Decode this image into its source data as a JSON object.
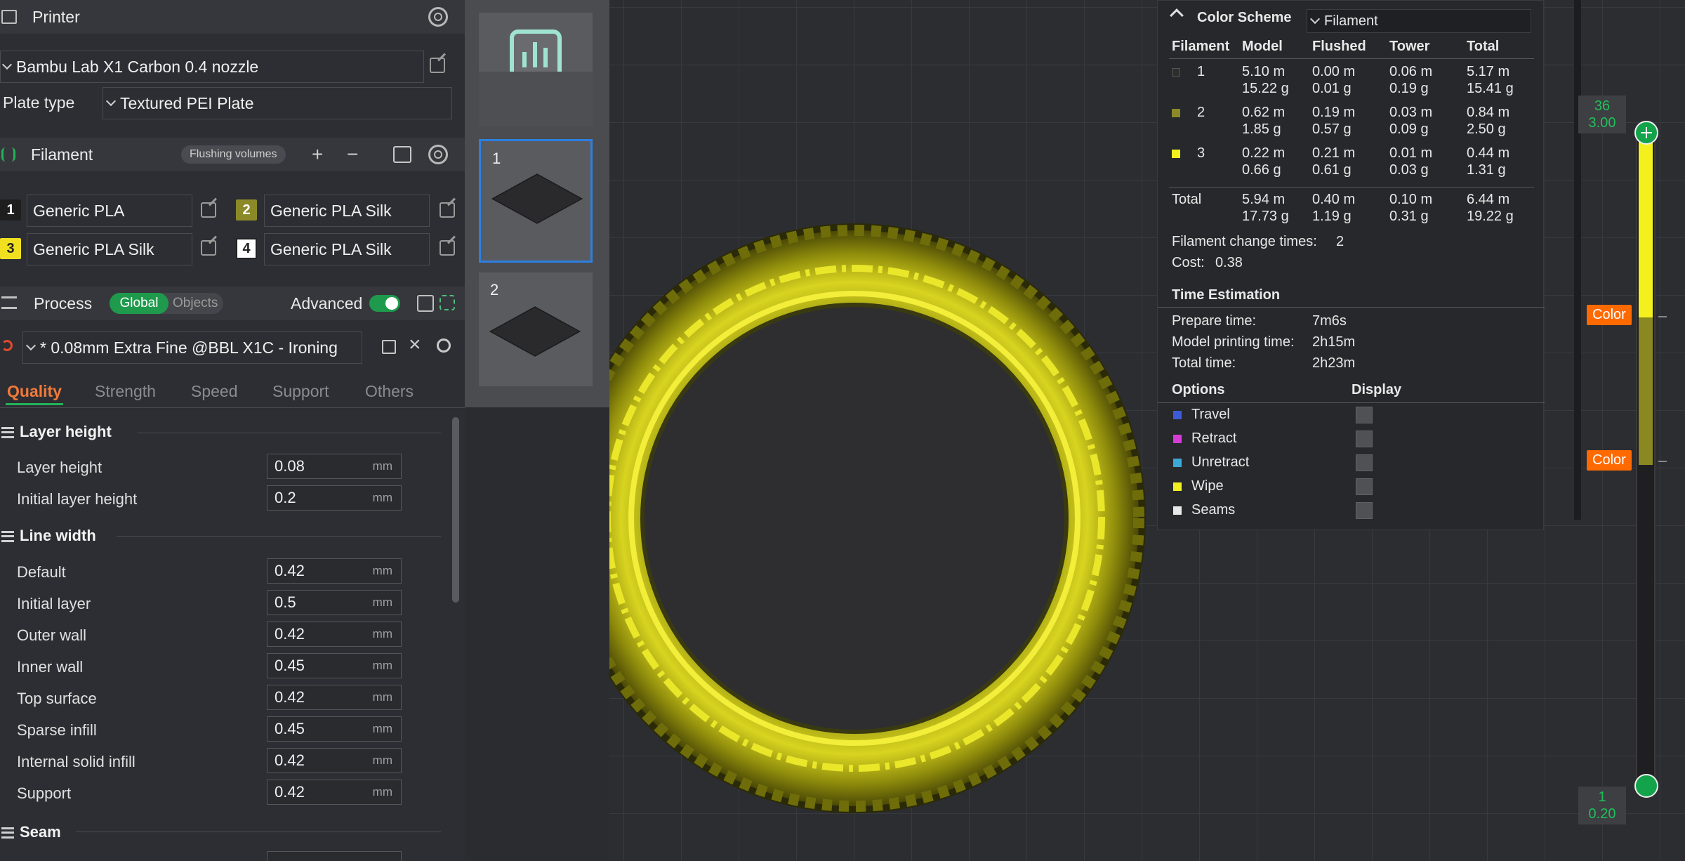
{
  "printer": {
    "title": "Printer",
    "preset": "Bambu Lab X1 Carbon 0.4 nozzle",
    "plate_type_label": "Plate type",
    "plate_type_value": "Textured PEI Plate"
  },
  "filament": {
    "title": "Filament",
    "flushing_label": "Flushing volumes",
    "items": [
      {
        "index": "1",
        "name": "Generic PLA",
        "color": "#1e1e1e",
        "text_color": "#ffffff"
      },
      {
        "index": "2",
        "name": "Generic PLA Silk",
        "color": "#8c8a28",
        "text_color": "#ffffff"
      },
      {
        "index": "3",
        "name": "Generic PLA Silk",
        "color": "#f0e020",
        "text_color": "#222222"
      },
      {
        "index": "4",
        "name": "Generic PLA Silk",
        "color": "#ffffff",
        "text_color": "#222222"
      }
    ]
  },
  "process": {
    "title": "Process",
    "global_label": "Global",
    "objects_label": "Objects",
    "advanced_label": "Advanced",
    "preset": "* 0.08mm Extra Fine @BBL X1C - Ironing",
    "tabs": [
      "Quality",
      "Strength",
      "Speed",
      "Support",
      "Others"
    ],
    "groups": {
      "layer_height": {
        "title": "Layer height",
        "rows": [
          {
            "label": "Layer height",
            "value": "0.08",
            "unit": "mm"
          },
          {
            "label": "Initial layer height",
            "value": "0.2",
            "unit": "mm"
          }
        ]
      },
      "line_width": {
        "title": "Line width",
        "rows": [
          {
            "label": "Default",
            "value": "0.42",
            "unit": "mm"
          },
          {
            "label": "Initial layer",
            "value": "0.5",
            "unit": "mm"
          },
          {
            "label": "Outer wall",
            "value": "0.42",
            "unit": "mm"
          },
          {
            "label": "Inner wall",
            "value": "0.45",
            "unit": "mm"
          },
          {
            "label": "Top surface",
            "value": "0.42",
            "unit": "mm"
          },
          {
            "label": "Sparse infill",
            "value": "0.45",
            "unit": "mm"
          },
          {
            "label": "Internal solid infill",
            "value": "0.42",
            "unit": "mm"
          },
          {
            "label": "Support",
            "value": "0.42",
            "unit": "mm"
          }
        ]
      },
      "seam": {
        "title": "Seam"
      }
    }
  },
  "plates": [
    {
      "number": "1"
    },
    {
      "number": "2"
    }
  ],
  "legend": {
    "color_scheme_label": "Color Scheme",
    "color_scheme_value": "Filament",
    "columns": [
      "Filament",
      "Model",
      "Flushed",
      "Tower",
      "Total"
    ],
    "rows": [
      {
        "id": "1",
        "swatch": "#2e2e2e",
        "model": [
          "5.10 m",
          "15.22 g"
        ],
        "flushed": [
          "0.00 m",
          "0.01 g"
        ],
        "tower": [
          "0.06 m",
          "0.19 g"
        ],
        "total": [
          "5.17 m",
          "15.41 g"
        ]
      },
      {
        "id": "2",
        "swatch": "#8c8a28",
        "model": [
          "0.62 m",
          "1.85 g"
        ],
        "flushed": [
          "0.19 m",
          "0.57 g"
        ],
        "tower": [
          "0.03 m",
          "0.09 g"
        ],
        "total": [
          "0.84 m",
          "2.50 g"
        ]
      },
      {
        "id": "3",
        "swatch": "#f0f020",
        "model": [
          "0.22 m",
          "0.66 g"
        ],
        "flushed": [
          "0.21 m",
          "0.61 g"
        ],
        "tower": [
          "0.01 m",
          "0.03 g"
        ],
        "total": [
          "0.44 m",
          "1.31 g"
        ]
      }
    ],
    "total_row": {
      "label": "Total",
      "model": [
        "5.94 m",
        "17.73 g"
      ],
      "flushed": [
        "0.40 m",
        "1.19 g"
      ],
      "tower": [
        "0.10 m",
        "0.31 g"
      ],
      "total": [
        "6.44 m",
        "19.22 g"
      ]
    },
    "change_times_label": "Filament change times:",
    "change_times_value": "2",
    "cost_label": "Cost:",
    "cost_value": "0.38",
    "time_title": "Time Estimation",
    "prepare_label": "Prepare time:",
    "prepare_value": "7m6s",
    "model_time_label": "Model printing time:",
    "model_time_value": "2h15m",
    "total_time_label": "Total time:",
    "total_time_value": "2h23m",
    "options_label": "Options",
    "display_label": "Display",
    "options": [
      {
        "label": "Travel",
        "color": "#3d5bd6"
      },
      {
        "label": "Retract",
        "color": "#d63bd6"
      },
      {
        "label": "Unretract",
        "color": "#3ba9d6"
      },
      {
        "label": "Wipe",
        "color": "#f0f020"
      },
      {
        "label": "Seams",
        "color": "#e8e8e8"
      }
    ]
  },
  "slider": {
    "top_layer": "36",
    "top_height": "3.00",
    "bottom_layer": "1",
    "bottom_height": "0.20",
    "color_tag": "Color"
  }
}
